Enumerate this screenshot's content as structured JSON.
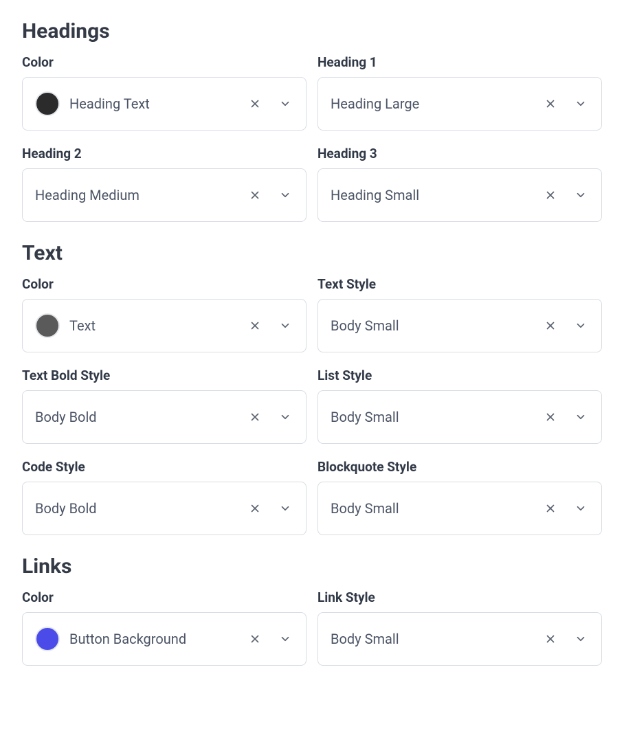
{
  "sections": {
    "headings": {
      "title": "Headings",
      "color": {
        "label": "Color",
        "valueLabel": "Heading Text",
        "swatchColor": "#2b2b2b"
      },
      "heading1": {
        "label": "Heading 1",
        "value": "Heading Large"
      },
      "heading2": {
        "label": "Heading 2",
        "value": "Heading Medium"
      },
      "heading3": {
        "label": "Heading 3",
        "value": "Heading Small"
      }
    },
    "text": {
      "title": "Text",
      "color": {
        "label": "Color",
        "valueLabel": "Text",
        "swatchColor": "#5a5a5a"
      },
      "textStyle": {
        "label": "Text Style",
        "value": "Body Small"
      },
      "textBoldStyle": {
        "label": "Text Bold Style",
        "value": "Body Bold"
      },
      "listStyle": {
        "label": "List Style",
        "value": "Body Small"
      },
      "codeStyle": {
        "label": "Code Style",
        "value": "Body Bold"
      },
      "blockquoteStyle": {
        "label": "Blockquote Style",
        "value": "Body Small"
      }
    },
    "links": {
      "title": "Links",
      "color": {
        "label": "Color",
        "valueLabel": "Button Background",
        "swatchColor": "#4a4be8"
      },
      "linkStyle": {
        "label": "Link Style",
        "value": "Body Small"
      }
    }
  }
}
